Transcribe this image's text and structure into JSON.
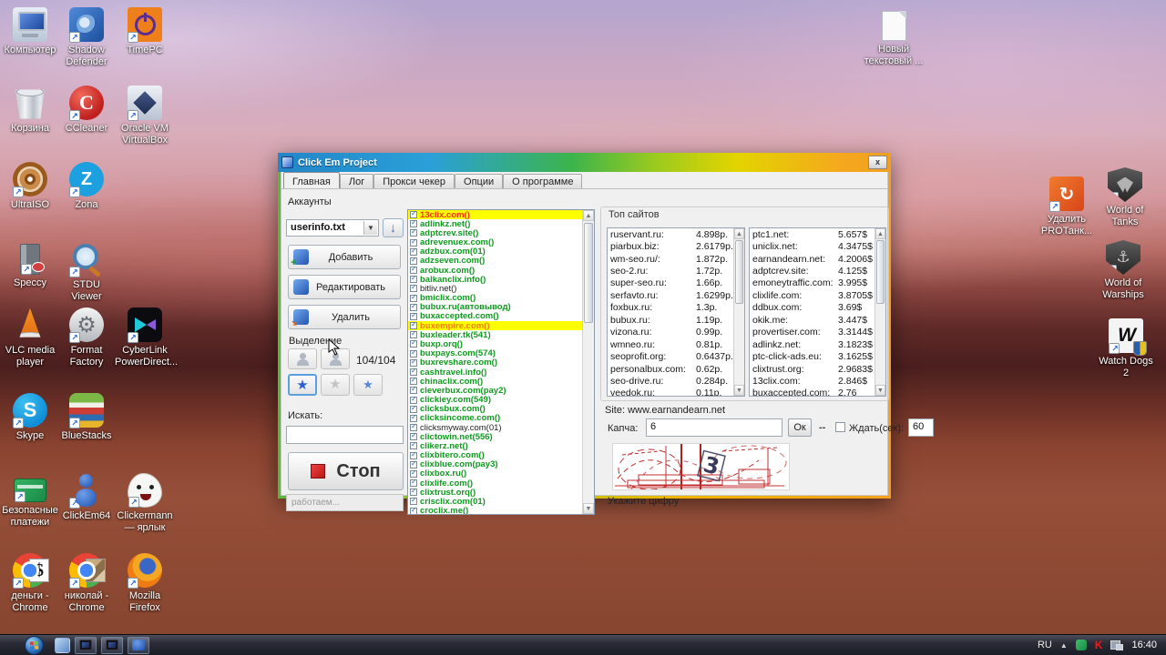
{
  "desktop": {
    "icons_left": [
      {
        "label": "Компьютер",
        "icon": "computer-icon",
        "shortcut": false
      },
      {
        "label": "Shadow Defender",
        "icon": "shadow-defender-icon",
        "shortcut": true
      },
      {
        "label": "TimePC",
        "icon": "timepc-icon",
        "shortcut": true
      },
      {
        "label": "Корзина",
        "icon": "recycle-bin-icon",
        "shortcut": false
      },
      {
        "label": "CCleaner",
        "icon": "ccleaner-icon",
        "shortcut": true,
        "glyph": "C"
      },
      {
        "label": "Oracle VM VirtualBox",
        "icon": "virtualbox-icon",
        "shortcut": true
      },
      {
        "label": "UltraISO",
        "icon": "ultraiso-icon",
        "shortcut": true
      },
      {
        "label": "Zona",
        "icon": "zona-icon",
        "shortcut": true,
        "glyph": "Z"
      },
      {
        "label": "Speccy",
        "icon": "speccy-icon",
        "shortcut": true
      },
      {
        "label": "STDU Viewer",
        "icon": "stdu-viewer-icon",
        "shortcut": true
      },
      {
        "label": "VLC media player",
        "icon": "vlc-icon",
        "shortcut": true
      },
      {
        "label": "Format Factory",
        "icon": "format-factory-icon",
        "shortcut": true,
        "glyph": "⚙"
      },
      {
        "label": "CyberLink PowerDirect...",
        "icon": "powerdirector-icon",
        "shortcut": true
      },
      {
        "label": "Skype",
        "icon": "skype-icon",
        "shortcut": true,
        "glyph": "S"
      },
      {
        "label": "BlueStacks",
        "icon": "bluestacks-icon",
        "shortcut": true
      },
      {
        "label": "Безопасные платежи",
        "icon": "safe-money-icon",
        "shortcut": true
      },
      {
        "label": "ClickEm64",
        "icon": "clickem-icon",
        "shortcut": true
      },
      {
        "label": "Clickermann — ярлык",
        "icon": "clickermann-icon",
        "shortcut": true
      },
      {
        "label": "деньги - Chrome",
        "icon": "chrome-icon",
        "shortcut": true,
        "overlay": "$"
      },
      {
        "label": "николай - Chrome",
        "icon": "chrome-icon",
        "shortcut": true,
        "overlay": "photo"
      },
      {
        "label": "Mozilla Firefox",
        "icon": "firefox-icon",
        "shortcut": true
      }
    ],
    "icons_right": [
      {
        "label": "Новый текстовый ...",
        "icon": "text-file-icon",
        "shortcut": false
      },
      {
        "label": "Удалить PROТанк...",
        "icon": "uninstall-protank-icon",
        "shortcut": true,
        "glyph": "↻"
      },
      {
        "label": "World of Tanks",
        "icon": "world-of-tanks-icon",
        "shortcut": true
      },
      {
        "label": "World of Warships",
        "icon": "world-of-warships-icon",
        "shortcut": true,
        "glyph": "⚓"
      },
      {
        "label": "Watch Dogs 2",
        "icon": "watch-dogs-2-icon",
        "shortcut": true,
        "glyph": "W"
      }
    ]
  },
  "window": {
    "title": "Click Em Project",
    "close_label": "x",
    "tabs": [
      "Главная",
      "Лог",
      "Прокси чекер",
      "Опции",
      "О программе"
    ],
    "accounts_label": "Аккаунты",
    "account_file": "userinfo.txt",
    "add_label": "Добавить",
    "edit_label": "Редактировать",
    "delete_label": "Удалить",
    "selection_label": "Выделение",
    "counter": "104/104",
    "search_label": "Искать:",
    "search_value": "",
    "stop_label": "Стоп",
    "status_text": "работаем...",
    "sites": [
      {
        "t": "13clix.com()",
        "s": "hl-red"
      },
      {
        "t": "adlinkz.net()",
        "s": "green"
      },
      {
        "t": "adptcrev.site()",
        "s": "green"
      },
      {
        "t": "adrevenuex.com()",
        "s": "green"
      },
      {
        "t": "adzbux.com(01)",
        "s": "green"
      },
      {
        "t": "adzseven.com()",
        "s": "green"
      },
      {
        "t": "arobux.com()",
        "s": "green"
      },
      {
        "t": "balkanclix.info()",
        "s": "green"
      },
      {
        "t": "bitliv.net()",
        "s": "black"
      },
      {
        "t": "bmiclix.com()",
        "s": "green"
      },
      {
        "t": "bubux.ru(автовывод)",
        "s": "green"
      },
      {
        "t": "buxaccepted.com()",
        "s": "green"
      },
      {
        "t": "buxempire.com()",
        "s": "hl-orange"
      },
      {
        "t": "buxleader.tk(541)",
        "s": "green"
      },
      {
        "t": "buxp.orq()",
        "s": "green"
      },
      {
        "t": "buxpays.com(574)",
        "s": "green"
      },
      {
        "t": "buxrevshare.com()",
        "s": "green"
      },
      {
        "t": "cashtravel.info()",
        "s": "green"
      },
      {
        "t": "chinaclix.com()",
        "s": "green"
      },
      {
        "t": "cleverbux.com(pay2)",
        "s": "green"
      },
      {
        "t": "clickiey.com(549)",
        "s": "green"
      },
      {
        "t": "clicksbux.com()",
        "s": "green"
      },
      {
        "t": "clicksincome.com()",
        "s": "green"
      },
      {
        "t": "clicksmyway.com(01)",
        "s": "black"
      },
      {
        "t": "clictowin.net(556)",
        "s": "green"
      },
      {
        "t": "clikerz.net()",
        "s": "green"
      },
      {
        "t": "clixbitero.com()",
        "s": "green"
      },
      {
        "t": "clixblue.com(pay3)",
        "s": "green"
      },
      {
        "t": "clixbox.ru()",
        "s": "green"
      },
      {
        "t": "clixlife.com()",
        "s": "green"
      },
      {
        "t": "clixtrust.orq()",
        "s": "green"
      },
      {
        "t": "crisclix.com(01)",
        "s": "green"
      },
      {
        "t": "croclix.me()",
        "s": "green"
      }
    ],
    "top_sites": {
      "label": "Топ сайтов",
      "left": [
        {
          "n": "ruservant.ru:",
          "v": "4.898p."
        },
        {
          "n": "piarbux.biz:",
          "v": "2.6179p."
        },
        {
          "n": "wm-seo.ru/:",
          "v": "1.872p."
        },
        {
          "n": "seo-2.ru:",
          "v": "1.72p."
        },
        {
          "n": "super-seo.ru:",
          "v": "1.66p."
        },
        {
          "n": "serfavto.ru:",
          "v": "1.6299p."
        },
        {
          "n": "foxbux.ru:",
          "v": "1.3p."
        },
        {
          "n": "bubux.ru:",
          "v": "1.19p."
        },
        {
          "n": "vizona.ru:",
          "v": "0.99p."
        },
        {
          "n": "wmneo.ru:",
          "v": "0.81p."
        },
        {
          "n": "seoprofit.org:",
          "v": "0.6437p."
        },
        {
          "n": "personalbux.com:",
          "v": "0.62p."
        },
        {
          "n": "seo-drive.ru:",
          "v": "0.284p."
        },
        {
          "n": "veedok.ru:",
          "v": "0.11p."
        }
      ],
      "right": [
        {
          "n": "ptc1.net:",
          "v": "5.657$"
        },
        {
          "n": "uniclix.net:",
          "v": "4.3475$"
        },
        {
          "n": "earnandearn.net:",
          "v": "4.2006$"
        },
        {
          "n": "adptcrev.site:",
          "v": "4.125$"
        },
        {
          "n": "emoneytraffic.com:",
          "v": "3.995$"
        },
        {
          "n": "clixlife.com:",
          "v": "3.8705$"
        },
        {
          "n": "ddbux.com:",
          "v": "3.69$"
        },
        {
          "n": "okik.me:",
          "v": "3.447$"
        },
        {
          "n": "provertiser.com:",
          "v": "3.3144$"
        },
        {
          "n": "adlinkz.net:",
          "v": "3.1823$"
        },
        {
          "n": "ptc-click-ads.eu:",
          "v": "3.1625$"
        },
        {
          "n": "clixtrust.org:",
          "v": "2.9683$"
        },
        {
          "n": "13clix.com:",
          "v": "2.846$"
        },
        {
          "n": "buxaccepted.com:",
          "v": "2.76"
        }
      ]
    },
    "site_line": "Site: www.earnandearn.net",
    "captcha": {
      "label": "Капча:",
      "value": "6",
      "ok_label": "Ок",
      "dashes": "--",
      "wait_label": "Ждать(сек):",
      "wait_value": "60",
      "digit": "3",
      "hint": "Укажите цифру"
    }
  },
  "taskbar": {
    "lang": "RU",
    "time": "16:40"
  }
}
